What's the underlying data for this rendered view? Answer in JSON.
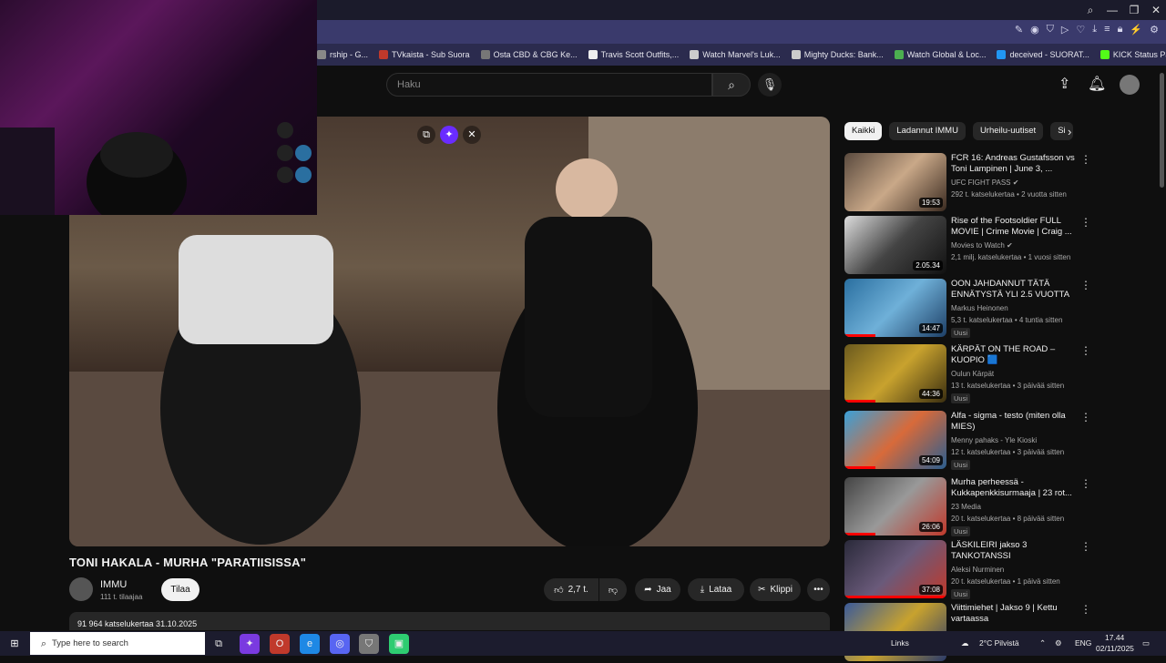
{
  "browser": {
    "bookmarks": [
      {
        "label": "rship - G...",
        "color": "#888"
      },
      {
        "label": "TVkaista - Sub Suora",
        "color": "#c0392b"
      },
      {
        "label": "Osta CBD & CBG Ke...",
        "color": "#777"
      },
      {
        "label": "Travis Scott Outfits,...",
        "color": "#eee"
      },
      {
        "label": "Watch Marvel's Luk...",
        "color": "#ccc"
      },
      {
        "label": "Mighty Ducks: Bank...",
        "color": "#ccc"
      },
      {
        "label": "Watch Global & Loc...",
        "color": "#4caf50"
      },
      {
        "label": "deceived - SUORAT...",
        "color": "#2196f3"
      },
      {
        "label": "KICK Status Page",
        "color": "#53fc18"
      }
    ]
  },
  "header": {
    "search_placeholder": "Haku"
  },
  "video": {
    "title": "TONI HAKALA - MURHA \"PARATIISISSA\"",
    "channel": "IMMU",
    "subscribers": "111 t. tilaajaa",
    "subscribe_label": "Tilaa",
    "likes": "2,7 t.",
    "share_label": "Jaa",
    "download_label": "Lataa",
    "clip_label": "Klippi",
    "views_date": "91 964 katselukertaa  31.10.2025"
  },
  "chips": [
    "Kaikki",
    "Ladannut IMMU",
    "Urheilu-uutiset",
    "Si"
  ],
  "recommendations": [
    {
      "title": "FCR 16: Andreas Gustafsson vs Toni Lampinen | June 3, ...",
      "channel": "UFC FIGHT PASS ✔",
      "meta": "292 t. katselukertaa • 2 vuotta sitten",
      "duration": "19:53",
      "badge": "",
      "thumb": "linear-gradient(135deg,#5a4a3e,#c9a888,#3a2a20)"
    },
    {
      "title": "Rise of the Footsoldier FULL MOVIE | Crime Movie | Craig ...",
      "channel": "Movies to Watch ✔",
      "meta": "2,1 milj. katselukertaa • 1 vuosi sitten",
      "duration": "2.05.34",
      "badge": "",
      "thumb": "linear-gradient(135deg,#ddd,#444,#111)"
    },
    {
      "title": "OON JAHDANNUT TÄTÄ ENNÄTYSTÄ YLI 2.5 VUOTTA",
      "channel": "Markus Heinonen",
      "meta": "5,3 t. katselukertaa • 4 tuntia sitten",
      "duration": "14:47",
      "badge": "Uusi",
      "thumb": "linear-gradient(135deg,#2a6fa0,#6fb0d8,#1d3f66)"
    },
    {
      "title": "KÄRPÄT ON THE ROAD – KUOPIO 🟦",
      "channel": "Oulun Kärpät",
      "meta": "13 t. katselukertaa • 3 päivää sitten",
      "duration": "44:36",
      "badge": "Uusi",
      "thumb": "linear-gradient(135deg,#6b5a1e,#c8a22e,#3a2e10)"
    },
    {
      "title": "Alfa - sigma - testo (miten olla MIES)",
      "channel": "Menny pahaks - Yle Kioski",
      "meta": "12 t. katselukertaa • 3 päivää sitten",
      "duration": "54:09",
      "badge": "Uusi",
      "thumb": "linear-gradient(135deg,#3aa0d8,#d86a3a,#2a5e90)"
    },
    {
      "title": "Murha perheessä - Kukkapenkkisurmaaja | 23 rot...",
      "channel": "23 Media",
      "meta": "20 t. katselukertaa • 8 päivää sitten",
      "duration": "26:06",
      "badge": "Uusi",
      "thumb": "linear-gradient(135deg,#444,#999,#c0392b)"
    },
    {
      "title": "LÄSKILEIRI jakso 3 TANKOTANSSI",
      "channel": "Aleksi Nurminen",
      "meta": "20 t. katselukertaa • 1 päivä sitten",
      "duration": "37:08",
      "badge": "Uusi",
      "thumb": "linear-gradient(135deg,#2a2a3a,#6a5a7a,#c0392b)"
    },
    {
      "title": "Viittimiehet | Jakso 9 | Kettu vartaassa",
      "channel": "",
      "meta": "",
      "duration": "",
      "badge": "",
      "thumb": "linear-gradient(135deg,#3a5a9a,#c8a22e,#2a3a6a)"
    }
  ],
  "taskbar": {
    "search_placeholder": "Type here to search",
    "links_label": "Links",
    "weather": "2°C  Pilvistä",
    "lang": "ENG",
    "time": "17.44",
    "date": "02/11/2025"
  }
}
